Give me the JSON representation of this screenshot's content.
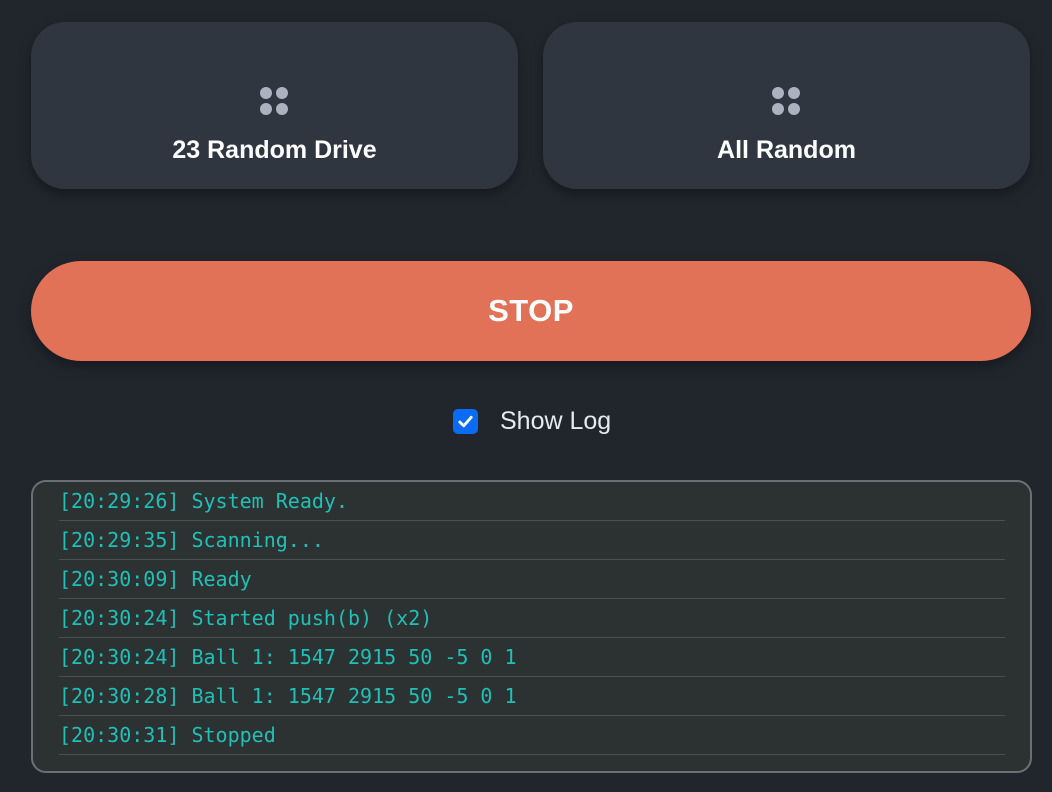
{
  "modes": [
    {
      "label": "23 Random Drive",
      "icon": "grid-dots-icon"
    },
    {
      "label": "All Random",
      "icon": "grid-dots-icon"
    }
  ],
  "stop": {
    "label": "STOP",
    "color": "#e27257"
  },
  "show_log": {
    "label": "Show Log",
    "checked": true,
    "accent": "#0a6cf5"
  },
  "log": {
    "text_color": "#1fc0b8",
    "lines": [
      "[20:29:26] System Ready.",
      "[20:29:35] Scanning...",
      "[20:30:09] Ready",
      "[20:30:24] Started push(b) (x2)",
      "[20:30:24] Ball 1: 1547 2915 50 -5 0 1",
      "[20:30:28] Ball 1: 1547 2915 50 -5 0 1",
      "[20:30:31] Stopped"
    ]
  }
}
